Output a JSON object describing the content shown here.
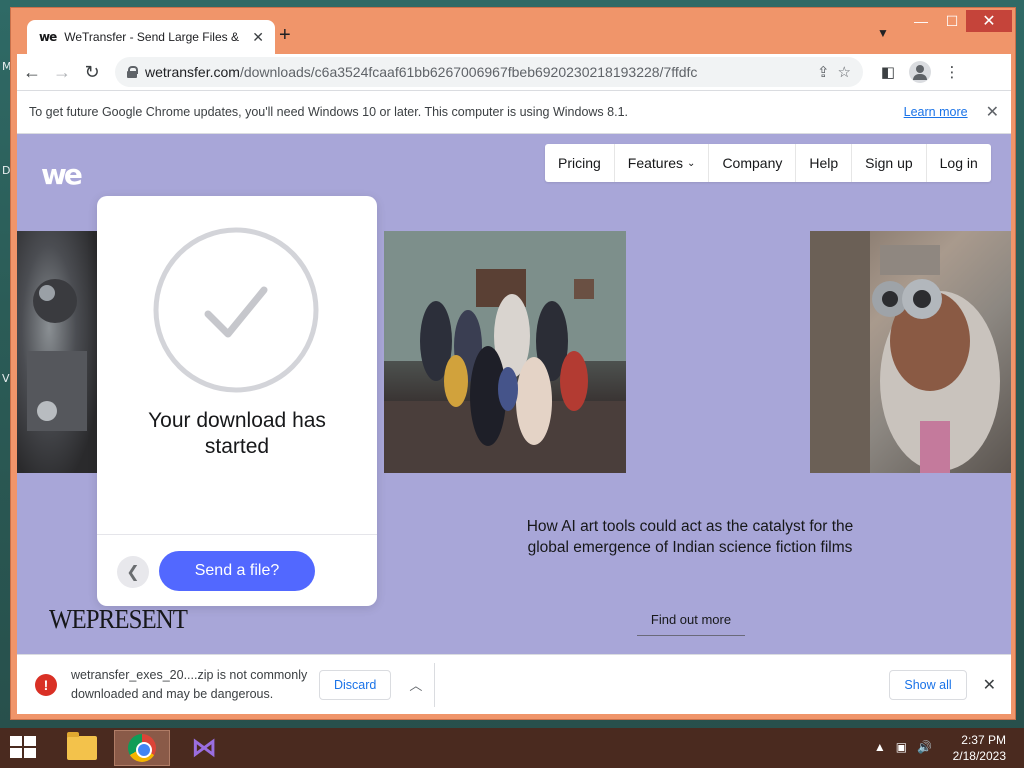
{
  "desktop": {
    "icon_letters": [
      "M",
      "D",
      "V"
    ]
  },
  "browser": {
    "tab_favicon": "we",
    "tab_title": "WeTransfer - Send Large Files & Share Photos Online",
    "url_host": "wetransfer.com",
    "url_path": "/downloads/c6a3524fcaaf61bb6267006967fbeb6920230218193228/7ffdfc",
    "infobar_text": "To get future Google Chrome updates, you'll need Windows 10 or later. This computer is using Windows 8.1.",
    "infobar_link": "Learn more"
  },
  "site": {
    "logo": "we",
    "nav": [
      "Pricing",
      "Features",
      "Company",
      "Help",
      "Sign up",
      "Log in"
    ],
    "panel_title": "Your download has started",
    "send_button": "Send a file?",
    "article_text": "How AI art tools could act as the catalyst for the global emergence of Indian science fiction films",
    "find_out_more": "Find out more",
    "wepresent": "WEPRESENT",
    "accent_color": "#5268ff",
    "background_color": "#a8a6d8"
  },
  "download_bar": {
    "message": "wetransfer_exes_20....zip is not commonly downloaded and may be dangerous.",
    "discard": "Discard",
    "show_all": "Show all"
  },
  "taskbar": {
    "apps": [
      "file-explorer",
      "google-chrome",
      "visual-studio"
    ],
    "time": "2:37 PM",
    "date": "2/18/2023"
  }
}
